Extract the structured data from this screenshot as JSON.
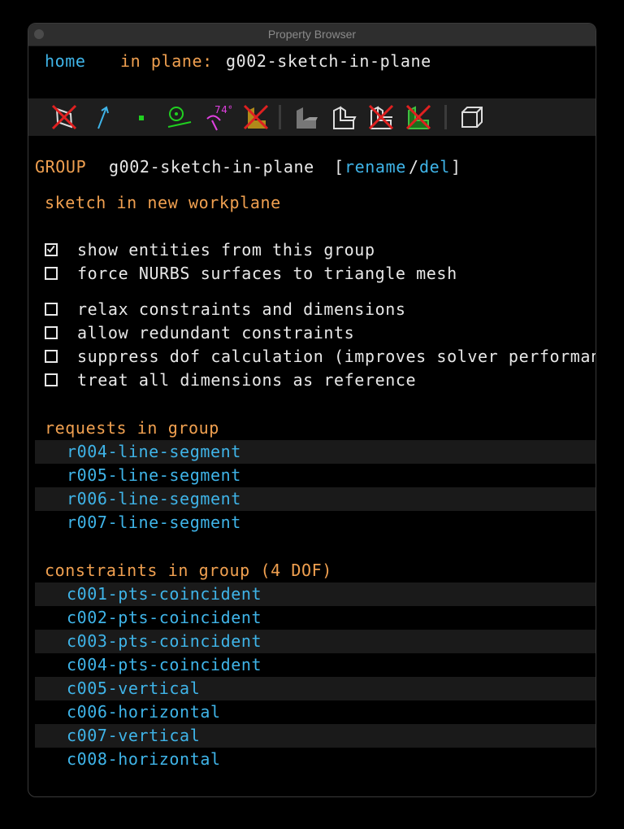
{
  "window": {
    "title": "Property Browser"
  },
  "nav": {
    "home": "home",
    "in_plane_label": "in plane:",
    "in_plane_value": "g002-sketch-in-plane"
  },
  "toolbar": {
    "icons": [
      "hide-workplanes-icon",
      "normals-icon",
      "points-icon",
      "constraints-icon",
      "dimension-angle-icon",
      "hide-faces-icon",
      "shaded-solid-icon",
      "edges-icon",
      "hidden-lines-icon",
      "outlines-icon",
      "perspective-box-icon"
    ],
    "angle_text": "74°"
  },
  "group": {
    "label": "GROUP",
    "name": "g002-sketch-in-plane",
    "bracket_open": "[",
    "rename": "rename",
    "slash": "/",
    "del": "del",
    "bracket_close": "]",
    "type": "sketch in new workplane"
  },
  "options": [
    {
      "label": "show entities from this group",
      "checked": true
    },
    {
      "label": "force NURBS surfaces to triangle mesh",
      "checked": false
    },
    {
      "label": "relax constraints and dimensions",
      "checked": false
    },
    {
      "label": "allow redundant constraints",
      "checked": false
    },
    {
      "label": "suppress dof calculation (improves solver performance)",
      "checked": false
    },
    {
      "label": "treat all dimensions as reference",
      "checked": false
    }
  ],
  "requests": {
    "heading": "requests in group",
    "items": [
      "r004-line-segment",
      "r005-line-segment",
      "r006-line-segment",
      "r007-line-segment"
    ]
  },
  "constraints": {
    "heading": "constraints in group (4 DOF)",
    "items": [
      "c001-pts-coincident",
      "c002-pts-coincident",
      "c003-pts-coincident",
      "c004-pts-coincident",
      "c005-vertical",
      "c006-horizontal",
      "c007-vertical",
      "c008-horizontal"
    ]
  },
  "colors": {
    "link": "#3fb4e8",
    "heading": "#f0a050",
    "text": "#e8e8e8",
    "check": "#e8e8e8"
  }
}
